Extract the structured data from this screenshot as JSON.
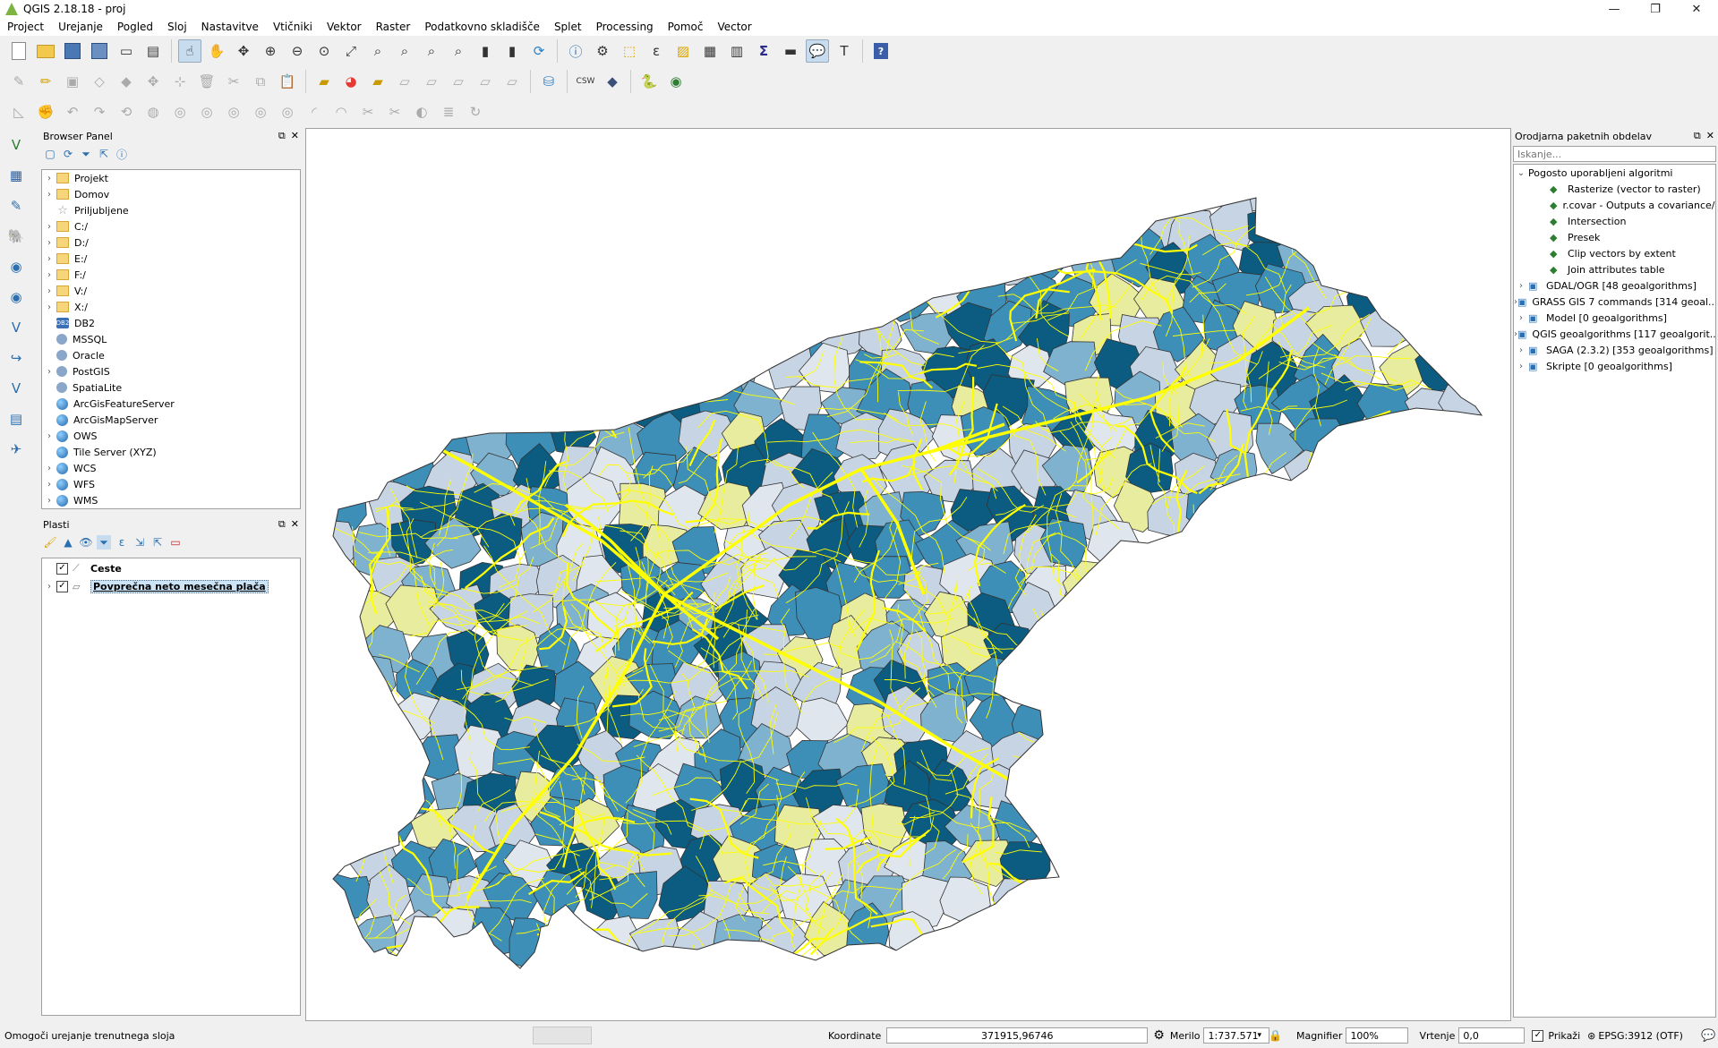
{
  "window": {
    "title": "QGIS 2.18.18 - proj",
    "minimize": "—",
    "maximize": "❐",
    "close": "✕"
  },
  "menu": [
    "Project",
    "Urejanje",
    "Pogled",
    "Sloj",
    "Nastavitve",
    "Vtičniki",
    "Vektor",
    "Raster",
    "Podatkovno skladišče",
    "Splet",
    "Processing",
    "Pomoč",
    "Vector"
  ],
  "browser": {
    "title": "Browser Panel",
    "items": [
      {
        "label": "Projekt",
        "icon": "folder-icon",
        "expand": true
      },
      {
        "label": "Domov",
        "icon": "folder-icon",
        "expand": true
      },
      {
        "label": "Priljubljene",
        "icon": "star-icon",
        "expand": false
      },
      {
        "label": "C:/",
        "icon": "folder-icon",
        "expand": true
      },
      {
        "label": "D:/",
        "icon": "folder-icon",
        "expand": true
      },
      {
        "label": "E:/",
        "icon": "folder-icon",
        "expand": true
      },
      {
        "label": "F:/",
        "icon": "folder-icon",
        "expand": true
      },
      {
        "label": "V:/",
        "icon": "folder-icon",
        "expand": true
      },
      {
        "label": "X:/",
        "icon": "folder-icon",
        "expand": true
      },
      {
        "label": "DB2",
        "icon": "db2-icon",
        "expand": false,
        "badge": "DB2"
      },
      {
        "label": "MSSQL",
        "icon": "mssql-icon",
        "expand": false
      },
      {
        "label": "Oracle",
        "icon": "oracle-icon",
        "expand": false
      },
      {
        "label": "PostGIS",
        "icon": "postgis-icon",
        "expand": true
      },
      {
        "label": "SpatiaLite",
        "icon": "spatialite-icon",
        "expand": false
      },
      {
        "label": "ArcGisFeatureServer",
        "icon": "globe-icon",
        "expand": false
      },
      {
        "label": "ArcGisMapServer",
        "icon": "globe-icon",
        "expand": false
      },
      {
        "label": "OWS",
        "icon": "globe-icon",
        "expand": true
      },
      {
        "label": "Tile Server (XYZ)",
        "icon": "globe-icon",
        "expand": false
      },
      {
        "label": "WCS",
        "icon": "globe-icon",
        "expand": true
      },
      {
        "label": "WFS",
        "icon": "globe-icon",
        "expand": true
      },
      {
        "label": "WMS",
        "icon": "globe-icon",
        "expand": true
      }
    ]
  },
  "layers": {
    "title": "Plasti",
    "items": [
      {
        "label": "Ceste",
        "checked": true,
        "selected": false,
        "expand": false
      },
      {
        "label": "Povprečna neto mesečna plača",
        "checked": true,
        "selected": true,
        "expand": true
      }
    ]
  },
  "toolbox": {
    "title": "Orodjarna paketnih obdelav",
    "search_placeholder": "Iskanje...",
    "group": "Pogosto uporabljeni algoritmi",
    "recent": [
      {
        "label": "Rasterize (vector to raster)",
        "icon": "rasterize-icon"
      },
      {
        "label": "r.covar - Outputs a covariance/...",
        "icon": "grass-icon"
      },
      {
        "label": "Intersection",
        "icon": "intersection-icon"
      },
      {
        "label": "Presek",
        "icon": "saga-icon"
      },
      {
        "label": "Clip vectors by extent",
        "icon": "clip-icon"
      },
      {
        "label": "Join attributes table",
        "icon": "join-icon"
      }
    ],
    "providers": [
      {
        "label": "GDAL/OGR [48 geoalgorithms]",
        "icon": "gdal-icon"
      },
      {
        "label": "GRASS GIS 7 commands [314 geoal...",
        "icon": "grass-icon"
      },
      {
        "label": "Model [0 geoalgorithms]",
        "icon": "model-icon"
      },
      {
        "label": "QGIS geoalgorithms [117 geoalgorit...",
        "icon": "qgis-icon"
      },
      {
        "label": "SAGA (2.3.2) [353 geoalgorithms]",
        "icon": "saga-icon"
      },
      {
        "label": "Skripte [0 geoalgorithms]",
        "icon": "script-icon"
      }
    ]
  },
  "status": {
    "message": "Omogoči urejanje trenutnega sloja",
    "coord_label": "Koordinate",
    "coord_value": "371915,96746",
    "scale_label": "Merilo",
    "scale_value": "1:737.571",
    "magnifier_label": "Magnifier",
    "magnifier_value": "100%",
    "rotation_label": "Vrtenje",
    "rotation_value": "0,0",
    "render_label": "Prikaži",
    "crs": "EPSG:3912 (OTF)"
  },
  "map_colors": {
    "dark": "#0b5c80",
    "mid": "#3d8fb8",
    "light": "#7fb2cf",
    "pale": "#c7d4e3",
    "paler": "#dfe6ee",
    "lightyellow": "#e8ec9e",
    "road": "#ffff00",
    "border": "#333333"
  }
}
